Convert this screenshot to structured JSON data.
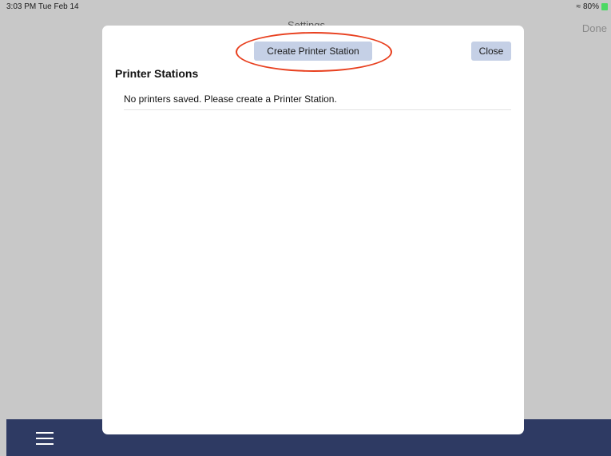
{
  "status_bar": {
    "time": "3:03 PM  Tue Feb 14",
    "battery": "80%"
  },
  "background": {
    "title": "Settings",
    "done_label": "Done"
  },
  "modal": {
    "create_button_label": "Create Printer Station",
    "close_button_label": "Close",
    "section_title": "Printer Stations",
    "empty_message": "No printers saved. Please create a Printer Station."
  },
  "colors": {
    "bottom_bar": "#2e3a63",
    "button_bg": "#c5d0e6",
    "highlight": "#e8401f"
  },
  "icons": [
    "wifi-icon",
    "battery-icon",
    "menu-icon"
  ]
}
